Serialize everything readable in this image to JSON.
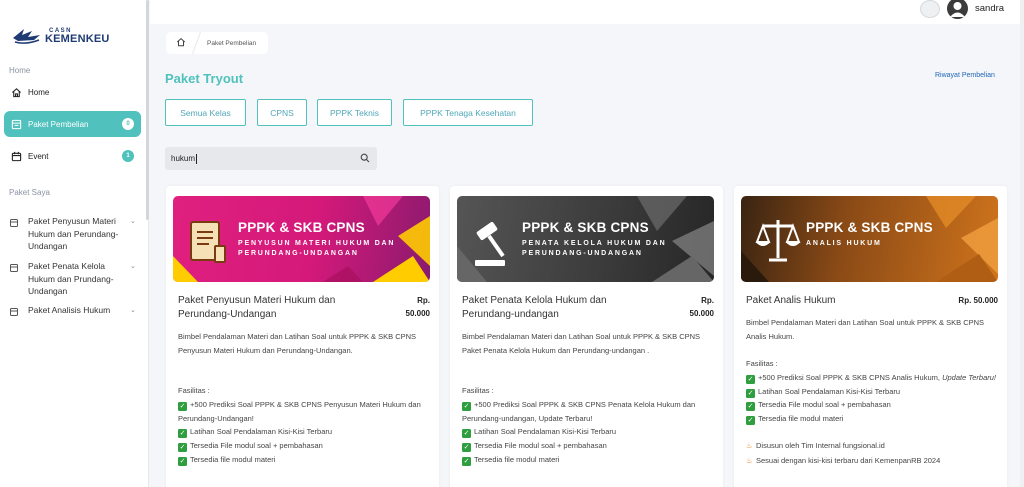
{
  "brand": {
    "small": "CASN",
    "large": "KEMENKEU"
  },
  "sidebar": {
    "home_section": "Home",
    "home_label": "Home",
    "paket_pembelian_label": "Paket Pembelian",
    "paket_pembelian_badge": "0",
    "event_label": "Event",
    "event_badge": "1",
    "paket_saya_section": "Paket Saya",
    "packages": [
      {
        "label": "Paket Penyusun Materi Hukum dan Perundang-Undangan"
      },
      {
        "label": "Paket Penata Kelola Hukum dan Prundang-Undangan"
      },
      {
        "label": "Paket Analisis Hukum"
      }
    ]
  },
  "topbar": {
    "username": "sandra"
  },
  "breadcrumb": {
    "current": "Paket Pembelian"
  },
  "page": {
    "title": "Paket Tryout",
    "history_link": "Riwayat Pembelian"
  },
  "filters": [
    "Semua Kelas",
    "CPNS",
    "PPPK Teknis",
    "PPPK Tenaga Kesehatan"
  ],
  "search": {
    "value": "hukum"
  },
  "cards": [
    {
      "banner_title": "PPPK & SKB CPNS",
      "banner_subtitle": "PENYUSUN MATERI HUKUM DAN PERUNDANG-UNDANGAN",
      "title": "Paket Penyusun Materi Hukum dan Perundang-Undangan",
      "price_prefix": "Rp.",
      "price": "50.000",
      "description": "Bimbel Pendalaman Materi dan Latihan Soal untuk PPPK & SKB CPNS Penyusun Materi Hukum dan Perundang-Undangan.",
      "fasilitas_label": "Fasilitas :",
      "features": [
        "+500 Prediksi Soal PPPK & SKB CPNS Penyusun Materi Hukum dan Perundang-Undangan!",
        "Latihan Soal Pendalaman Kisi-Kisi Terbaru",
        "Tersedia File modul soal + pembahasan",
        "Tersedia file modul materi"
      ]
    },
    {
      "banner_title": "PPPK & SKB CPNS",
      "banner_subtitle": "PENATA KELOLA HUKUM DAN PERUNDANG-UNDANGAN",
      "title": "Paket Penata Kelola Hukum dan Perundang-undangan",
      "price_prefix": "Rp.",
      "price": "50.000",
      "description": "Bimbel Pendalaman Materi dan Latihan Soal untuk PPPK & SKB CPNS Paket Penata Kelola Hukum dan Perundang-undangan .",
      "fasilitas_label": "Fasilitas :",
      "features": [
        "+500 Prediksi Soal PPPK & SKB CPNS Penata Kelola Hukum dan Perundang-undangan, Update Terbaru!",
        "Latihan Soal Pendalaman Kisi-Kisi Terbaru",
        "Tersedia File modul soal + pembahasan",
        "Tersedia file modul materi"
      ]
    },
    {
      "banner_title": "PPPK & SKB CPNS",
      "banner_subtitle": "ANALIS HUKUM",
      "title": "Paket Analis Hukum",
      "price": "Rp. 50.000",
      "description": "Bimbel Pendalaman Materi dan Latihan Soal untuk PPPK & SKB CPNS Analis Hukum.",
      "fasilitas_label": "Fasilitas :",
      "feature1_main": "+500 Prediksi Soal PPPK & SKB CPNS Analis Hukum,",
      "feature1_em": "Update Terbaru!",
      "features_rest": [
        "Latihan Soal Pendalaman Kisi-Kisi Terbaru",
        "Tersedia File modul soal + pembahasan",
        "Tersedia file modul materi"
      ],
      "notes": [
        "Disusun oleh Tim Internal fungsional.id",
        "Sesuai dengan kisi-kisi terbaru dari KemenpanRB 2024"
      ]
    }
  ],
  "colors": {
    "accent": "#50c1bd",
    "card1": "#d81b7a",
    "card2": "#3a3a3a",
    "card3": "#c8691a"
  }
}
